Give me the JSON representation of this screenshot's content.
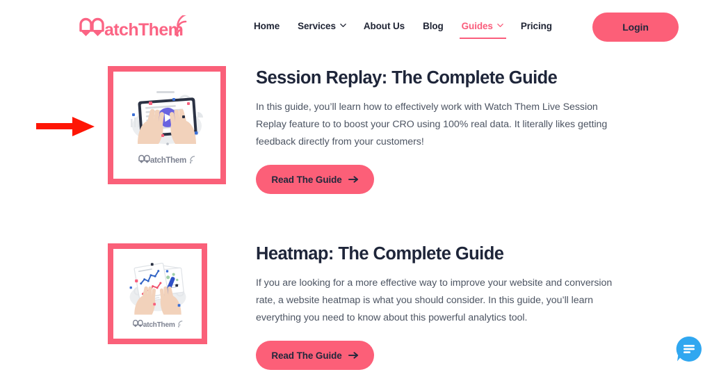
{
  "header": {
    "logo": {
      "name": "watchthem-logo",
      "text": "WatchThem",
      "color": "#fb6484"
    },
    "nav": [
      {
        "label": "Home",
        "has_dropdown": false,
        "active": false
      },
      {
        "label": "Services",
        "has_dropdown": true,
        "active": false
      },
      {
        "label": "About Us",
        "has_dropdown": false,
        "active": false
      },
      {
        "label": "Blog",
        "has_dropdown": false,
        "active": false
      },
      {
        "label": "Guides",
        "has_dropdown": true,
        "active": true
      },
      {
        "label": "Pricing",
        "has_dropdown": false,
        "active": false
      }
    ],
    "login_label": "Login"
  },
  "guides": [
    {
      "title": "Session Replay: The Complete Guide",
      "description": "In this guide, you’ll learn how to effectively work with Watch Them Live Session Replay feature to to boost your CRO using 100% real data. It literally likes getting feedback directly from your customers!",
      "cta_label": "Read The Guide",
      "cta_icon": "arrow-right-icon",
      "thumbnail": {
        "name": "session-replay-thumbnail",
        "art": "hands-holding-tablet-with-play-button",
        "logo_text": "WatchThem"
      }
    },
    {
      "title": "Heatmap: The Complete Guide",
      "description": "If you are looking for a more effective way to improve your website and conversion rate, a website heatmap is what you should consider. In this guide, you’ll learn everything you need to know about this powerful analytics tool.",
      "cta_label": "Read The Guide",
      "cta_icon": "arrow-right-icon",
      "thumbnail": {
        "name": "heatmap-thumbnail",
        "art": "hands-with-charts-and-pen",
        "logo_text": "WatchThem"
      }
    }
  ],
  "annotation": {
    "name": "red-pointer-arrow",
    "color": "#fe1605",
    "points_to": "session-replay-thumbnail"
  },
  "chat_widget": {
    "name": "chat-bubble-button",
    "icon": "chat-message-icon",
    "color": "#30a7f0"
  },
  "theme": {
    "accent_pink": "#fc5f78",
    "frame_pink": "#fa6079",
    "heading_navy": "#1e2539",
    "body_gray": "#4d5563",
    "background": "#ffffff"
  }
}
